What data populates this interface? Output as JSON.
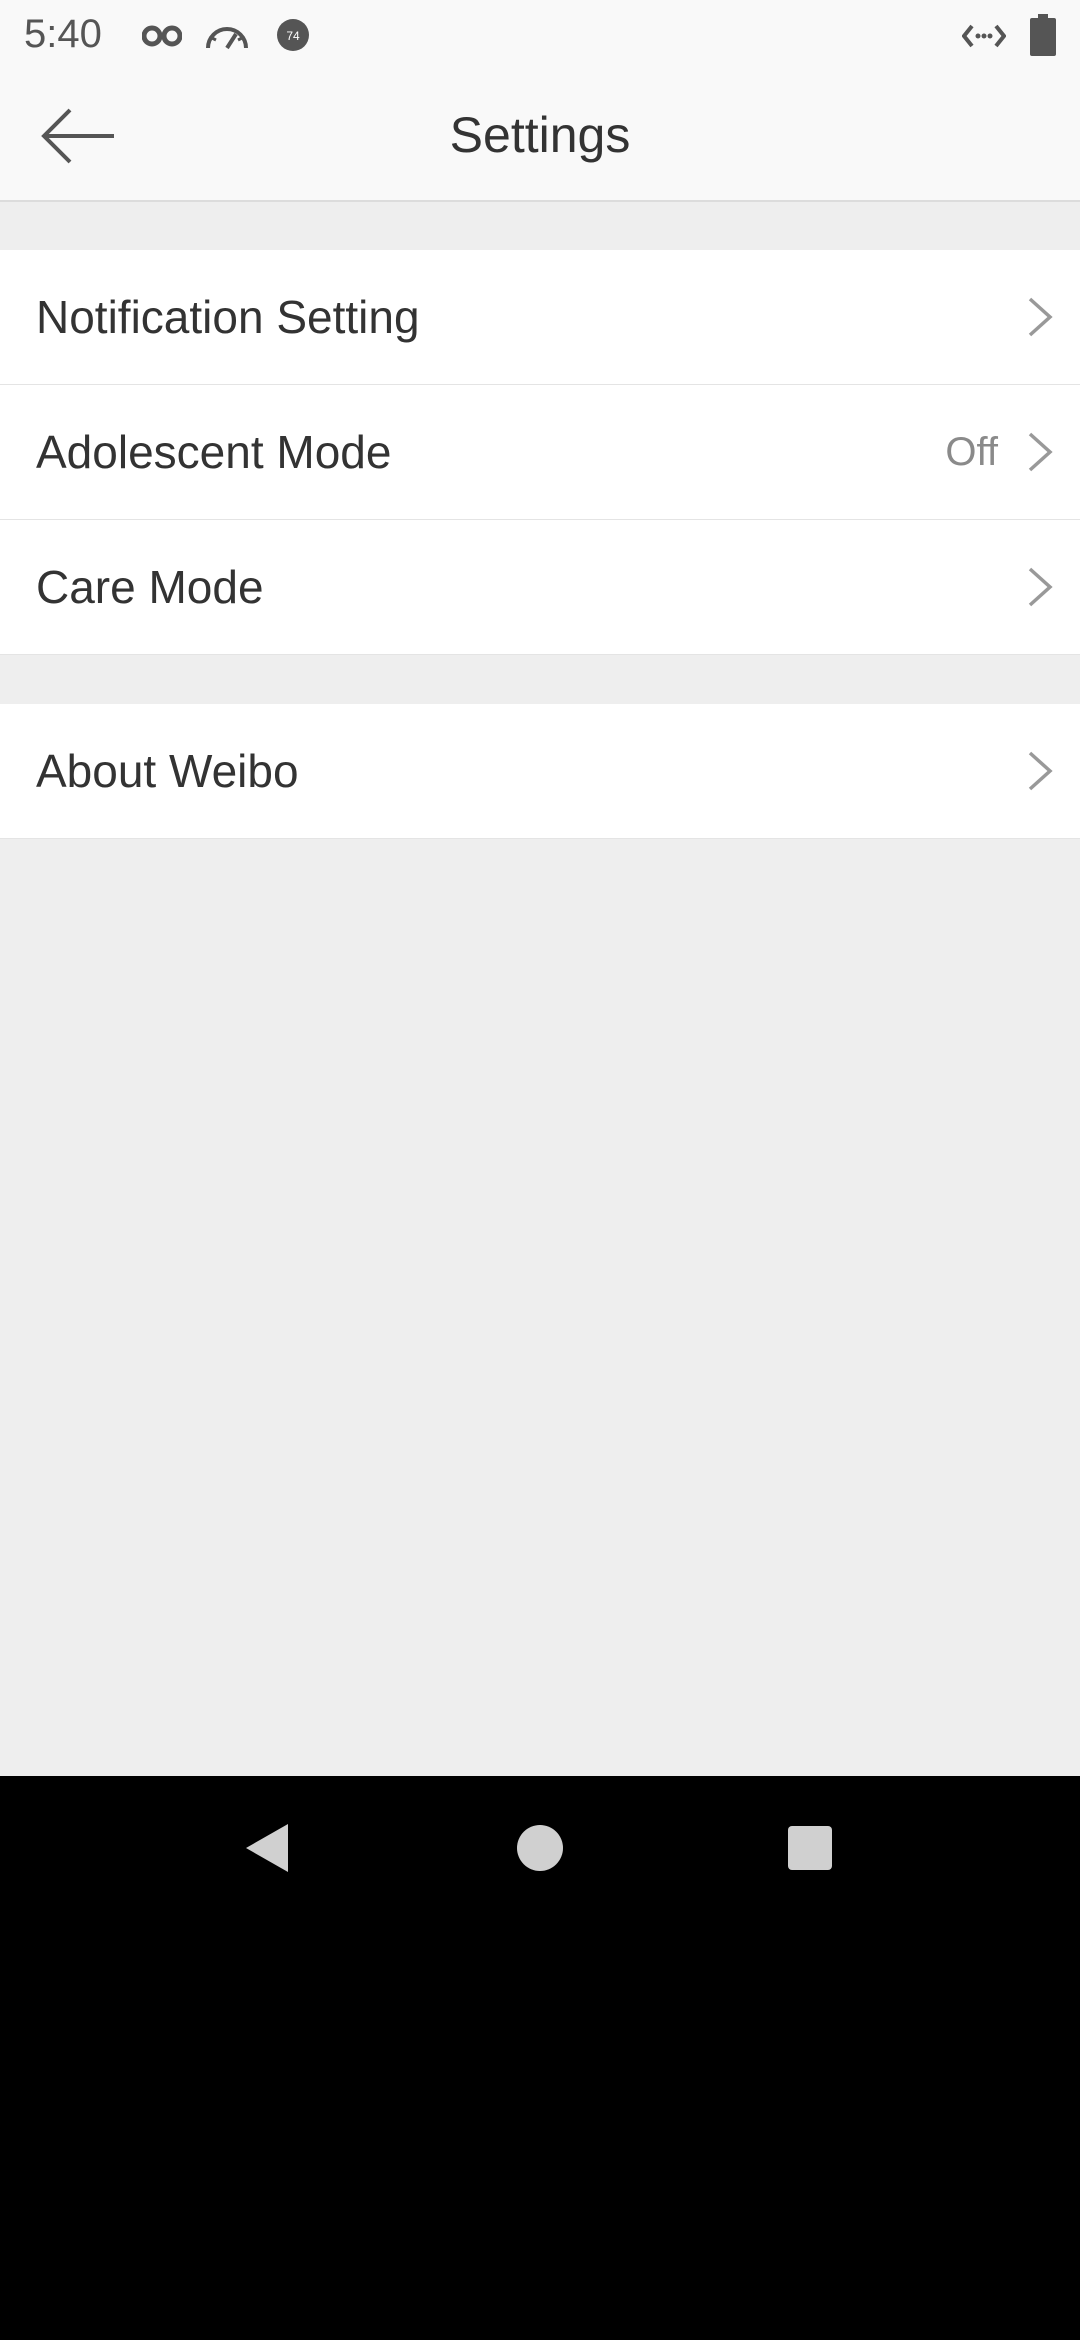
{
  "status_bar": {
    "time": "5:40",
    "icons": [
      "incognito-icon",
      "speedometer-icon",
      "badge-74-icon",
      "code-arrows-icon",
      "battery-icon"
    ],
    "badge_text": "74"
  },
  "app_bar": {
    "title": "Settings",
    "back_icon": "arrow-left-icon"
  },
  "groups": [
    {
      "items": [
        {
          "label": "Notification Setting",
          "value": ""
        },
        {
          "label": "Adolescent Mode",
          "value": "Off"
        },
        {
          "label": "Care Mode",
          "value": ""
        }
      ]
    },
    {
      "items": [
        {
          "label": "About Weibo",
          "value": ""
        }
      ]
    }
  ],
  "nav_bar": {
    "icons": [
      "back-triangle-icon",
      "home-circle-icon",
      "recents-square-icon"
    ]
  },
  "colors": {
    "background": "#eeeeee",
    "surface": "#ffffff",
    "text_primary": "#333333",
    "text_secondary": "#8a8a8a",
    "status_bar": "#f9f9f9"
  }
}
